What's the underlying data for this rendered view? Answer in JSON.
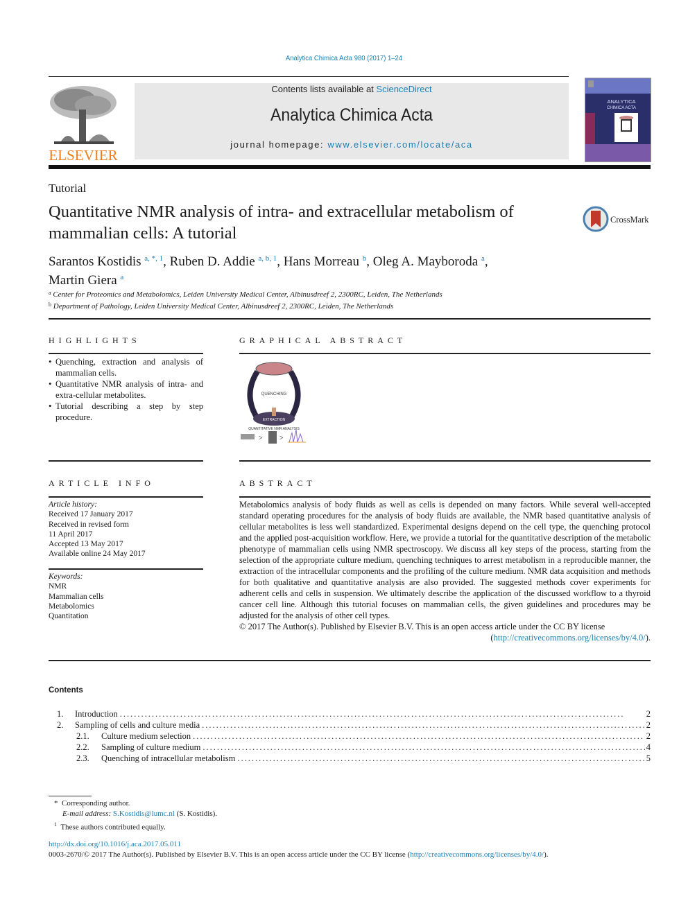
{
  "running_head": "Analytica Chimica Acta 980 (2017) 1–24",
  "masthead": {
    "publisher_logo_text": "ELSEVIER",
    "contents_prefix": "Contents lists available at ",
    "contents_link": "ScienceDirect",
    "journal_name": "Analytica Chimica Acta",
    "homepage_prefix": "journal homepage: ",
    "homepage_link": "www.elsevier.com/locate/aca",
    "cover_title_line1": "ANALYTICA",
    "cover_title_line2": "CHIMICA ACTA"
  },
  "article": {
    "type": "Tutorial",
    "title": "Quantitative NMR analysis of intra- and extracellular metabolism of mammalian cells: A tutorial",
    "crossmark_label": "CrossMark",
    "authors": [
      {
        "name": "Sarantos Kostidis",
        "sup": "a, *, 1",
        "sep": ", "
      },
      {
        "name": "Ruben D. Addie",
        "sup": "a, b, 1",
        "sep": ", "
      },
      {
        "name": "Hans Morreau",
        "sup": "b",
        "sep": ", "
      },
      {
        "name": "Oleg A. Mayboroda",
        "sup": "a",
        "sep": ","
      },
      {
        "name": "Martin Giera",
        "sup": "a",
        "sep": ""
      }
    ],
    "affiliations": [
      {
        "mark": "a",
        "text": "Center for Proteomics and Metabolomics, Leiden University Medical Center, Albinusdreef 2, 2300RC, Leiden, The Netherlands"
      },
      {
        "mark": "b",
        "text": "Department of Pathology, Leiden University Medical Center, Albinusdreef 2, 2300RC, Leiden, The Netherlands"
      }
    ]
  },
  "highlights": {
    "heading": "HIGHLIGHTS",
    "items": [
      "Quenching, extraction and analysis of mammalian cells.",
      "Quantitative NMR analysis of intra- and extra-cellular metabolites.",
      "Tutorial describing a step by step procedure."
    ]
  },
  "graphical_abstract": {
    "heading": "GRAPHICAL ABSTRACT",
    "label_quenching": "QUENCHING",
    "label_extraction": "EXTRACTION",
    "label_analysis": "QUANTITATIVE NMR ANALYSIS"
  },
  "article_info": {
    "heading": "ARTICLE INFO",
    "history_label": "Article history:",
    "history": [
      "Received 17 January 2017",
      "Received in revised form",
      "11 April 2017",
      "Accepted 13 May 2017",
      "Available online 24 May 2017"
    ],
    "keywords_label": "Keywords:",
    "keywords": [
      "NMR",
      "Mammalian cells",
      "Metabolomics",
      "Quantitation"
    ]
  },
  "abstract": {
    "heading": "ABSTRACT",
    "text": "Metabolomics analysis of body fluids as well as cells is depended on many factors. While several well-accepted standard operating procedures for the analysis of body fluids are available, the NMR based quantitative analysis of cellular metabolites is less well standardized. Experimental designs depend on the cell type, the quenching protocol and the applied post-acquisition workflow. Here, we provide a tutorial for the quantitative description of the metabolic phenotype of mammalian cells using NMR spectroscopy. We discuss all key steps of the process, starting from the selection of the appropriate culture medium, quenching techniques to arrest metabolism in a reproducible manner, the extraction of the intracellular components and the profiling of the culture medium. NMR data acquisition and methods for both qualitative and quantitative analysis are also provided. The suggested methods cover experiments for adherent cells and cells in suspension. We ultimately describe the application of the discussed workflow to a thyroid cancer cell line. Although this tutorial focuses on mammalian cells, the given guidelines and procedures may be adjusted for the analysis of other cell types.",
    "license_text": "© 2017 The Author(s). Published by Elsevier B.V. This is an open access article under the CC BY license",
    "license_open": "(",
    "license_link": "http://creativecommons.org/licenses/by/4.0/",
    "license_close": ")."
  },
  "contents": {
    "heading": "Contents",
    "items": [
      {
        "num": "1.",
        "title": "Introduction",
        "page": "2",
        "level": 1
      },
      {
        "num": "2.",
        "title": "Sampling of cells and culture media",
        "page": "2",
        "level": 1
      },
      {
        "num": "2.1.",
        "title": "Culture medium selection",
        "page": "2",
        "level": 2
      },
      {
        "num": "2.2.",
        "title": "Sampling of culture medium",
        "page": "4",
        "level": 2
      },
      {
        "num": "2.3.",
        "title": "Quenching of intracellular metabolism",
        "page": "5",
        "level": 2
      }
    ]
  },
  "footnotes": {
    "corresponding_mark": "*",
    "corresponding_text": "Corresponding author.",
    "email_label": "E-mail address:",
    "email": "S.Kostidis@lumc.nl",
    "email_suffix": " (S. Kostidis).",
    "equal_mark": "1",
    "equal_text": "These authors contributed equally."
  },
  "footer": {
    "doi_link": "http://dx.doi.org/10.1016/j.aca.2017.05.011",
    "issn_text": "0003-2670/© 2017 The Author(s). Published by Elsevier B.V. This is an open access article under the CC BY license (",
    "issn_link": "http://creativecommons.org/licenses/by/4.0/",
    "issn_close": ")."
  },
  "colors": {
    "link": "#1a7fb5",
    "elsevier_orange": "#f07d1a",
    "banner_gray": "#e8e8e8",
    "cover_navy": "#2a2f6a"
  }
}
